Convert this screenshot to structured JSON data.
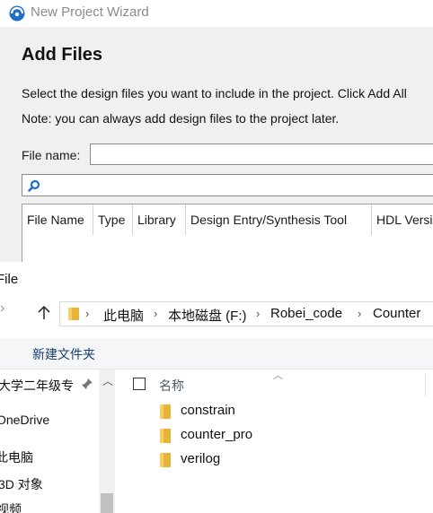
{
  "wizard": {
    "title": "New Project Wizard",
    "heading": "Add Files",
    "desc1": "Select the design files you want to include in the project. Click Add All",
    "desc2": "Note: you can always add design files to the project later.",
    "file_name_label": "File name:",
    "file_name_value": "",
    "table_headers": [
      "File Name",
      "Type",
      "Library",
      "Design Entry/Synthesis Tool",
      "HDL Version"
    ]
  },
  "explorer": {
    "title": "File",
    "breadcrumbs": [
      "此电脑",
      "本地磁盘 (F:)",
      "Robei_code",
      "Counter"
    ],
    "new_folder": "新建文件夹",
    "nav_items": [
      "大学二年级专",
      "OneDrive",
      "此电脑",
      "3D 对象",
      "视频"
    ],
    "column_name": "名称",
    "files": [
      "constrain",
      "counter_pro",
      "verilog"
    ]
  },
  "colors": {
    "folder": "#e8b33a",
    "accent": "#1e6fc8"
  }
}
